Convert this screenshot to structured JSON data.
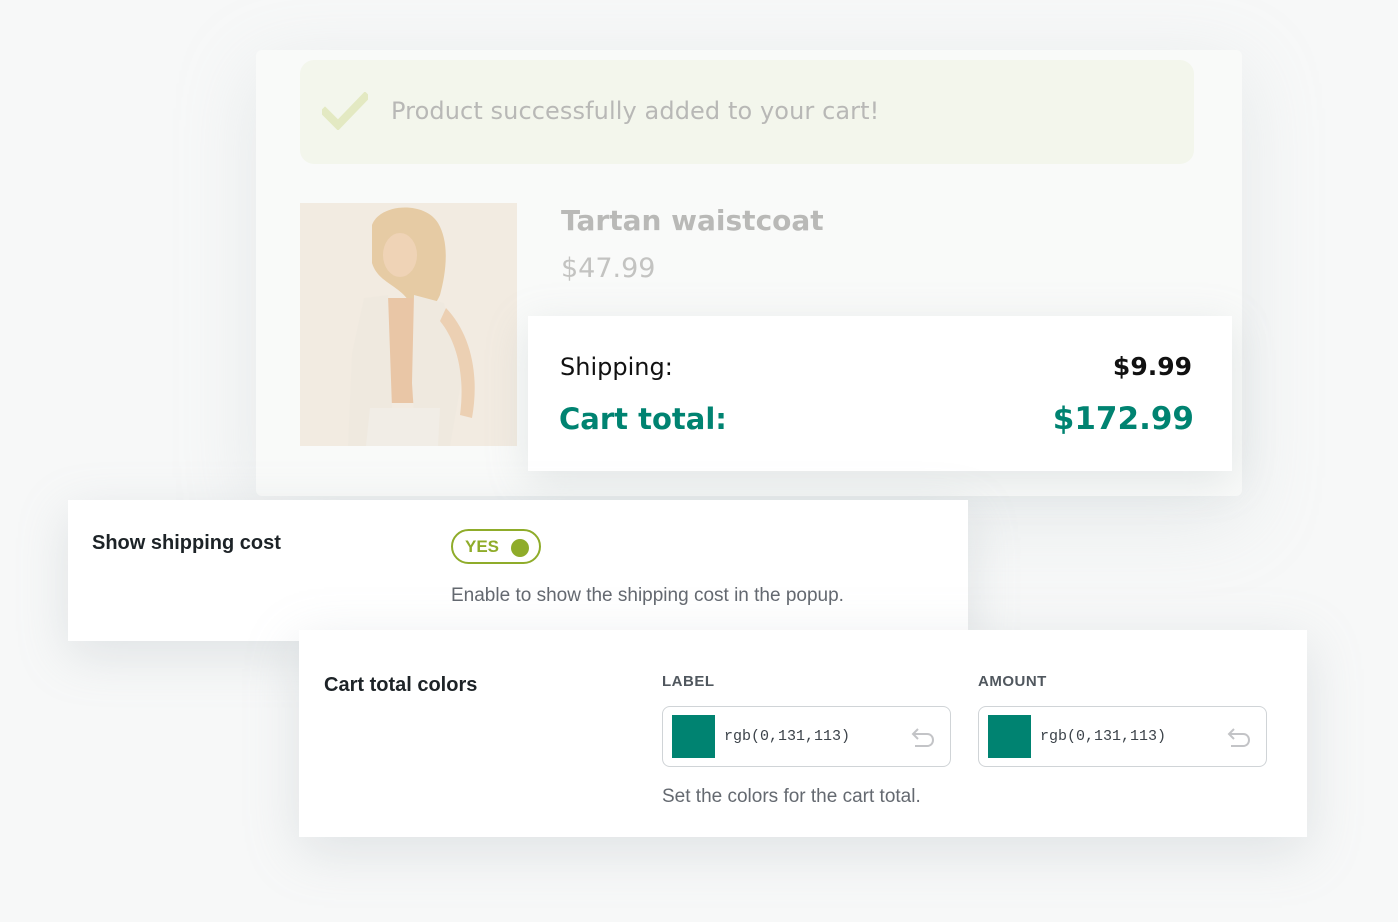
{
  "popup": {
    "notice_text": "Product successfully added to your cart!",
    "product_name": "Tartan waistcoat",
    "product_price": "$47.99",
    "shipping_label": "Shipping:",
    "shipping_amount": "$9.99",
    "cart_total_label": "Cart total:",
    "cart_total_amount": "$172.99"
  },
  "shipping_setting": {
    "title": "Show shipping cost",
    "toggle_label": "YES",
    "toggle_on": true,
    "description": "Enable to show the shipping cost in the popup."
  },
  "colors_setting": {
    "title": "Cart total colors",
    "label_column": "LABEL",
    "amount_column": "AMOUNT",
    "label_color": "rgb(0,131,113)",
    "amount_color": "rgb(0,131,113)",
    "description": "Set the colors for the cart total."
  },
  "colors": {
    "accent": "#008371",
    "toggle": "#8fac2a",
    "notice_bg": "#f3f6ec"
  },
  "icons": {
    "notice": "check-icon",
    "reset": "undo-icon"
  }
}
